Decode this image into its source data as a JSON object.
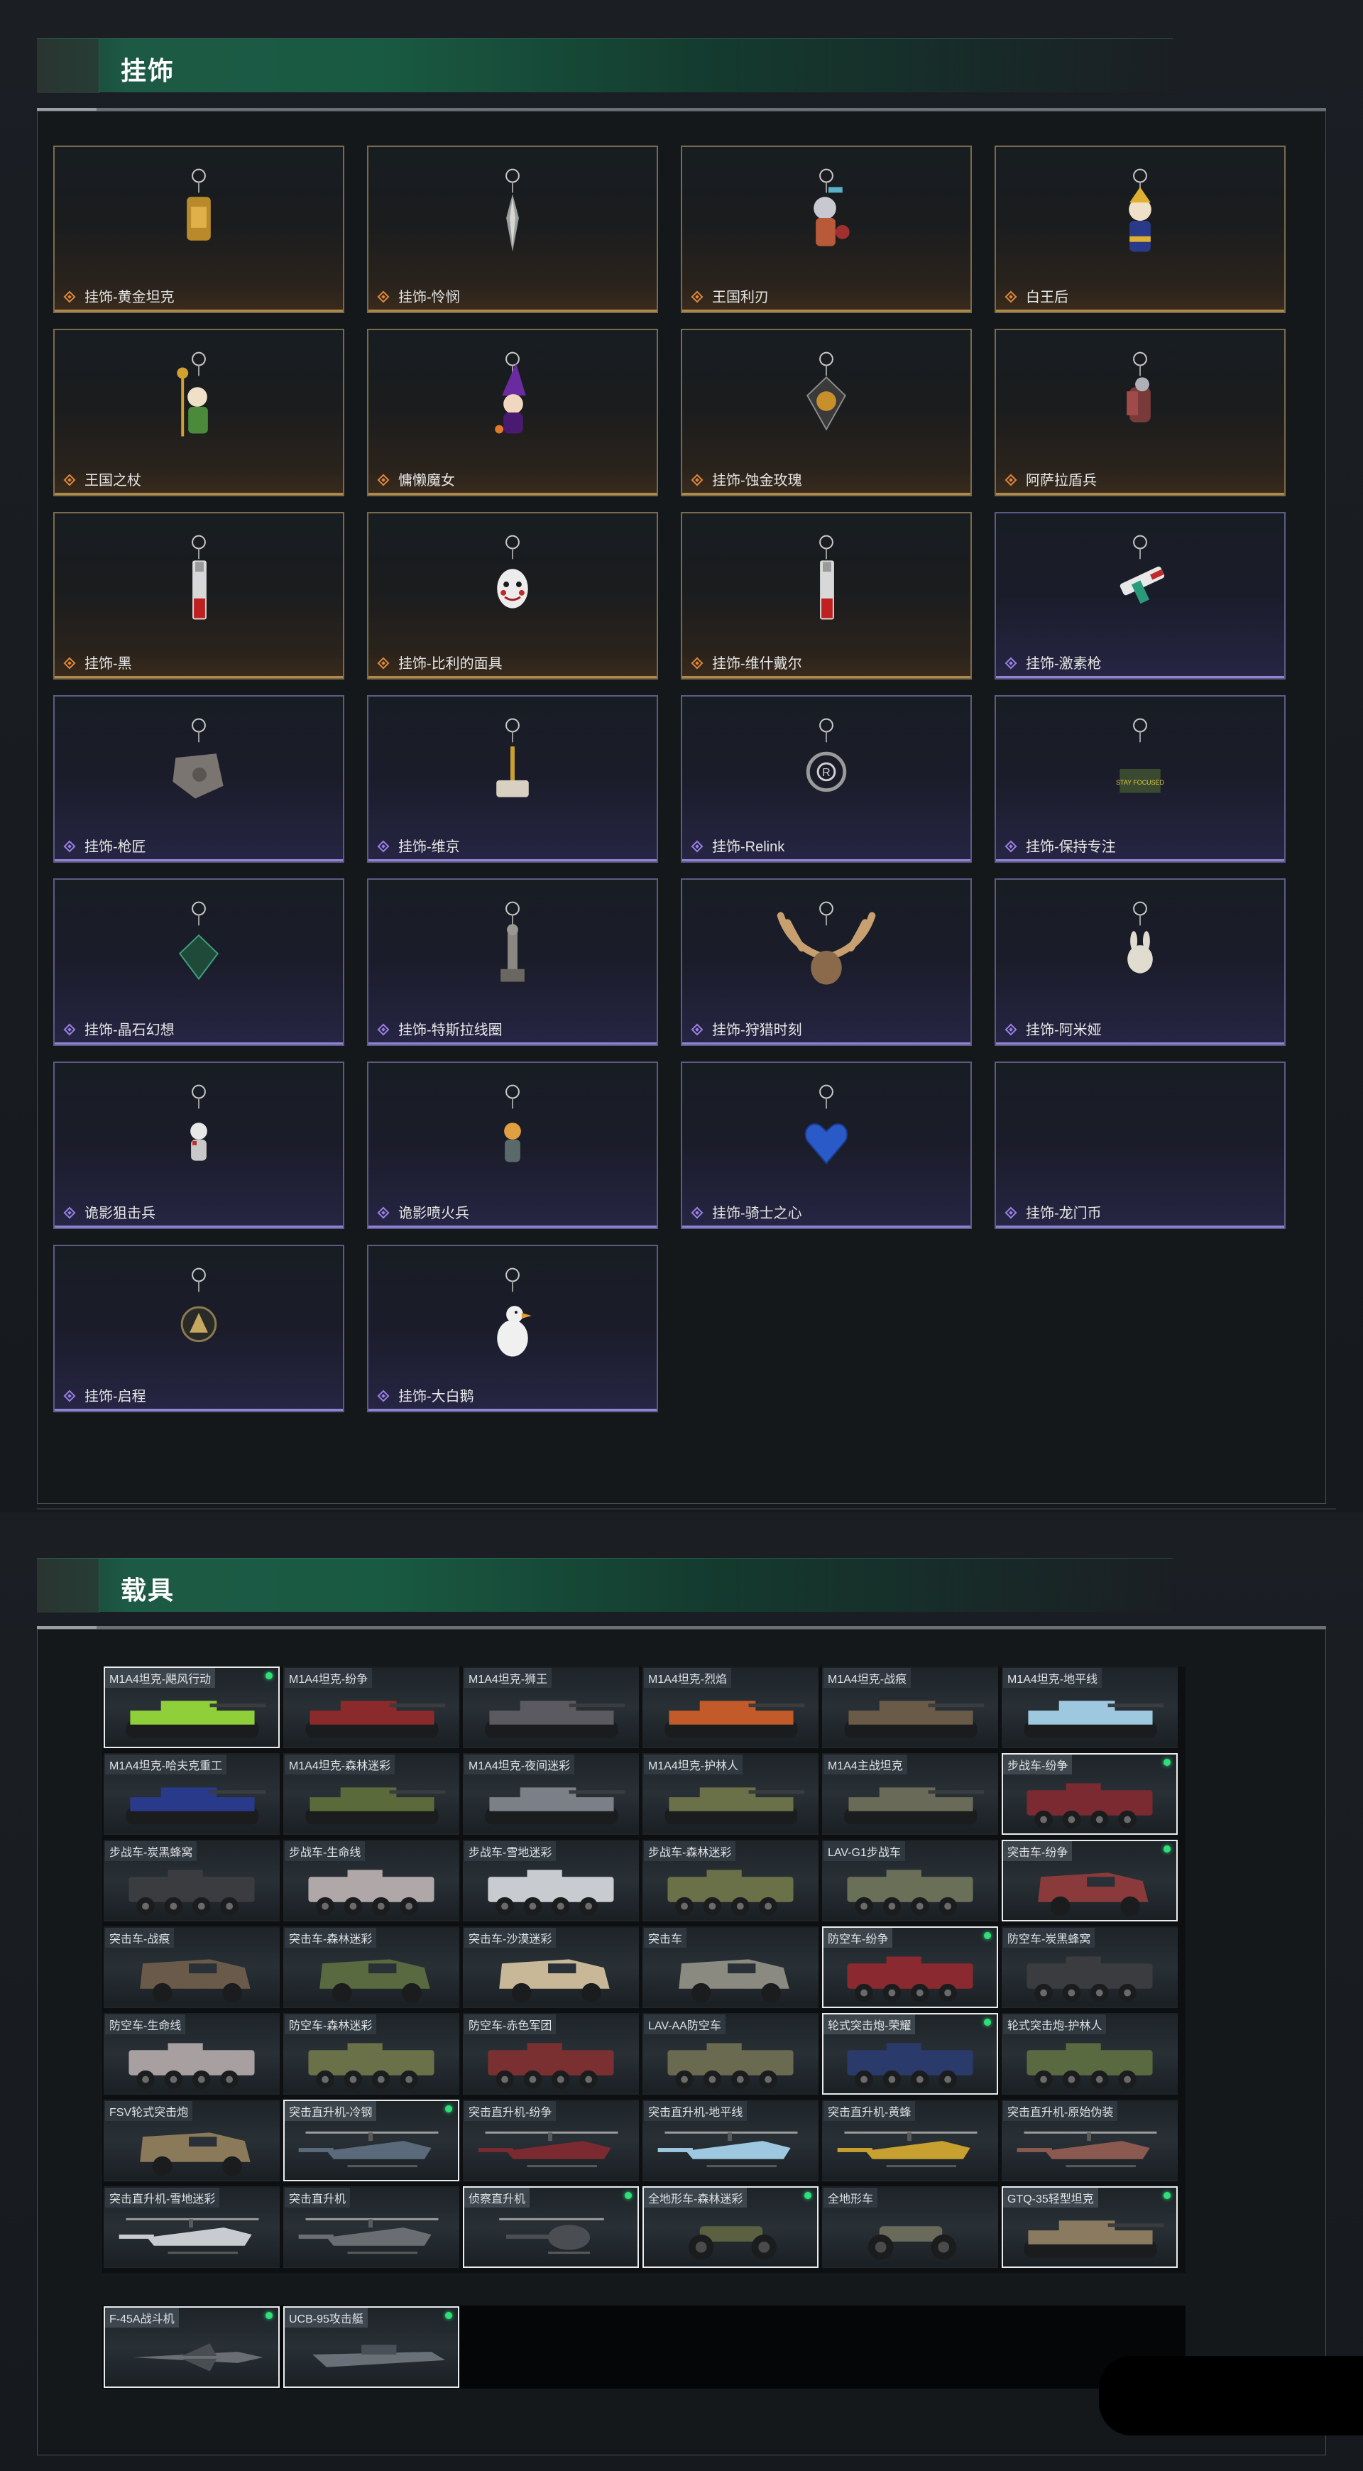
{
  "pendants_section": {
    "title": "挂饰",
    "items": [
      {
        "name": "挂饰-黄金坦克",
        "rarity": "gold",
        "icon": "gold-tank-charm-icon"
      },
      {
        "name": "挂饰-怜悯",
        "rarity": "gold",
        "icon": "blade-charm-icon"
      },
      {
        "name": "王国利刃",
        "rarity": "gold",
        "icon": "knight-figure-charm-icon"
      },
      {
        "name": "白王后",
        "rarity": "gold",
        "icon": "queen-figure-charm-icon"
      },
      {
        "name": "王国之杖",
        "rarity": "gold",
        "icon": "king-figure-charm-icon"
      },
      {
        "name": "慵懒魔女",
        "rarity": "gold",
        "icon": "witch-charm-icon"
      },
      {
        "name": "挂饰-蚀金玫瑰",
        "rarity": "gold",
        "icon": "rose-emblem-charm-icon"
      },
      {
        "name": "阿萨拉盾兵",
        "rarity": "gold",
        "icon": "shield-soldier-charm-icon"
      },
      {
        "name": "挂饰-黑",
        "rarity": "gold",
        "icon": "lighter-charm-icon"
      },
      {
        "name": "挂饰-比利的面具",
        "rarity": "gold",
        "icon": "mask-charm-icon"
      },
      {
        "name": "挂饰-维什戴尔",
        "rarity": "gold",
        "icon": "lighter-charm-icon"
      },
      {
        "name": "挂饰-激素枪",
        "rarity": "purple",
        "icon": "syringe-gun-charm-icon"
      },
      {
        "name": "挂饰-枪匠",
        "rarity": "purple",
        "icon": "gear-plate-charm-icon"
      },
      {
        "name": "挂饰-维京",
        "rarity": "purple",
        "icon": "hammer-charm-icon"
      },
      {
        "name": "挂饰-Relink",
        "rarity": "purple",
        "icon": "knot-charm-icon"
      },
      {
        "name": "挂饰-保持专注",
        "rarity": "purple",
        "icon": "sign-charm-icon",
        "sign_text": "STAY FOCUSED"
      },
      {
        "name": "挂饰-晶石幻想",
        "rarity": "purple",
        "icon": "crystal-charm-icon"
      },
      {
        "name": "挂饰-特斯拉线圈",
        "rarity": "purple",
        "icon": "tesla-coil-charm-icon"
      },
      {
        "name": "挂饰-狩猎时刻",
        "rarity": "purple",
        "icon": "antler-charm-icon"
      },
      {
        "name": "挂饰-阿米娅",
        "rarity": "purple",
        "icon": "bunny-charm-icon"
      },
      {
        "name": "诡影狙击兵",
        "rarity": "purple",
        "icon": "sniper-figure-charm-icon"
      },
      {
        "name": "诡影喷火兵",
        "rarity": "purple",
        "icon": "flamer-figure-charm-icon"
      },
      {
        "name": "挂饰-骑士之心",
        "rarity": "purple",
        "icon": "blue-heart-charm-icon"
      },
      {
        "name": "挂饰-龙门币",
        "rarity": "purple",
        "icon": "none"
      },
      {
        "name": "挂饰-启程",
        "rarity": "purple",
        "icon": "round-emblem-charm-icon"
      },
      {
        "name": "挂饰-大白鹅",
        "rarity": "purple",
        "icon": "goose-charm-icon"
      }
    ]
  },
  "vehicles_section": {
    "title": "载具",
    "items": [
      {
        "name": "M1A4坦克-飓风行动",
        "owned": true,
        "kind": "tank",
        "color": "#8fcf3a"
      },
      {
        "name": "M1A4坦克-纷争",
        "owned": false,
        "kind": "tank",
        "color": "#8a2a2a"
      },
      {
        "name": "M1A4坦克-狮王",
        "owned": false,
        "kind": "tank",
        "color": "#5a5a60"
      },
      {
        "name": "M1A4坦克-烈焰",
        "owned": false,
        "kind": "tank",
        "color": "#c25a2a"
      },
      {
        "name": "M1A4坦克-战痕",
        "owned": false,
        "kind": "tank",
        "color": "#6a5a48"
      },
      {
        "name": "M1A4坦克-地平线",
        "owned": false,
        "kind": "tank",
        "color": "#9ec8e0"
      },
      {
        "name": "M1A4坦克-哈夫克重工",
        "owned": false,
        "kind": "tank",
        "color": "#2a3a8a"
      },
      {
        "name": "M1A4坦克-森林迷彩",
        "owned": false,
        "kind": "tank",
        "color": "#5a6a3a"
      },
      {
        "name": "M1A4坦克-夜间迷彩",
        "owned": false,
        "kind": "tank",
        "color": "#7a7f88"
      },
      {
        "name": "M1A4坦克-护林人",
        "owned": false,
        "kind": "tank",
        "color": "#6a7048"
      },
      {
        "name": "M1A4主战坦克",
        "owned": false,
        "kind": "tank",
        "color": "#6a6a58"
      },
      {
        "name": "步战车-纷争",
        "owned": true,
        "kind": "ifv",
        "color": "#7a2a30"
      },
      {
        "name": "步战车-炭黑蜂窝",
        "owned": false,
        "kind": "ifv",
        "color": "#3a3c40"
      },
      {
        "name": "步战车-生命线",
        "owned": false,
        "kind": "ifv",
        "color": "#b0a8a8"
      },
      {
        "name": "步战车-雪地迷彩",
        "owned": false,
        "kind": "ifv",
        "color": "#c8ccd0"
      },
      {
        "name": "步战车-森林迷彩",
        "owned": false,
        "kind": "ifv",
        "color": "#6a7048"
      },
      {
        "name": "LAV-G1步战车",
        "owned": false,
        "kind": "ifv",
        "color": "#6a7058"
      },
      {
        "name": "突击车-纷争",
        "owned": true,
        "kind": "truck",
        "color": "#8a3a3a"
      },
      {
        "name": "突击车-战痕",
        "owned": false,
        "kind": "truck",
        "color": "#6a5a4a"
      },
      {
        "name": "突击车-森林迷彩",
        "owned": false,
        "kind": "truck",
        "color": "#5a6a40"
      },
      {
        "name": "突击车-沙漠迷彩",
        "owned": false,
        "kind": "truck",
        "color": "#c8b898"
      },
      {
        "name": "突击车",
        "owned": false,
        "kind": "truck",
        "color": "#8a8a80"
      },
      {
        "name": "防空车-纷争",
        "owned": true,
        "kind": "ifv",
        "color": "#8a2a30"
      },
      {
        "name": "防空车-炭黑蜂窝",
        "owned": false,
        "kind": "ifv",
        "color": "#3a3c40"
      },
      {
        "name": "防空车-生命线",
        "owned": false,
        "kind": "ifv",
        "color": "#a8a0a0"
      },
      {
        "name": "防空车-森林迷彩",
        "owned": false,
        "kind": "ifv",
        "color": "#6a7048"
      },
      {
        "name": "防空车-赤色军团",
        "owned": false,
        "kind": "ifv",
        "color": "#7a3030"
      },
      {
        "name": "LAV-AA防空车",
        "owned": false,
        "kind": "ifv",
        "color": "#6a6a50"
      },
      {
        "name": "轮式突击炮-荣耀",
        "owned": true,
        "kind": "ifv",
        "color": "#2a3a6a"
      },
      {
        "name": "轮式突击炮-护林人",
        "owned": false,
        "kind": "ifv",
        "color": "#5a6a40"
      },
      {
        "name": "FSV轮式突击炮",
        "owned": false,
        "kind": "truck",
        "color": "#8a7a5a"
      },
      {
        "name": "突击直升机-冷钢",
        "owned": true,
        "kind": "heli",
        "color": "#5a6a7a"
      },
      {
        "name": "突击直升机-纷争",
        "owned": false,
        "kind": "heli",
        "color": "#7a2a30"
      },
      {
        "name": "突击直升机-地平线",
        "owned": false,
        "kind": "heli",
        "color": "#9ec8e0"
      },
      {
        "name": "突击直升机-黄蜂",
        "owned": false,
        "kind": "heli",
        "color": "#c8a030"
      },
      {
        "name": "突击直升机-原始伪装",
        "owned": false,
        "kind": "heli",
        "color": "#8a5a50"
      },
      {
        "name": "突击直升机-雪地迷彩",
        "owned": false,
        "kind": "heli",
        "color": "#c8ccd0"
      },
      {
        "name": "突击直升机",
        "owned": false,
        "kind": "heli",
        "color": "#6a6e72"
      },
      {
        "name": "侦察直升机",
        "owned": true,
        "kind": "scout",
        "color": "#4a4e52"
      },
      {
        "name": "全地形车-森林迷彩",
        "owned": true,
        "kind": "atv",
        "color": "#5a6040"
      },
      {
        "name": "全地形车",
        "owned": false,
        "kind": "atv",
        "color": "#6a6a5a"
      },
      {
        "name": "GTQ-35轻型坦克",
        "owned": true,
        "kind": "tank",
        "color": "#8a7a60"
      }
    ],
    "extra_items": [
      {
        "name": "F-45A战斗机",
        "owned": true,
        "kind": "jet",
        "color": "#6a6e72"
      },
      {
        "name": "UCB-95攻击艇",
        "owned": true,
        "kind": "boat",
        "color": "#6a7078"
      }
    ]
  }
}
